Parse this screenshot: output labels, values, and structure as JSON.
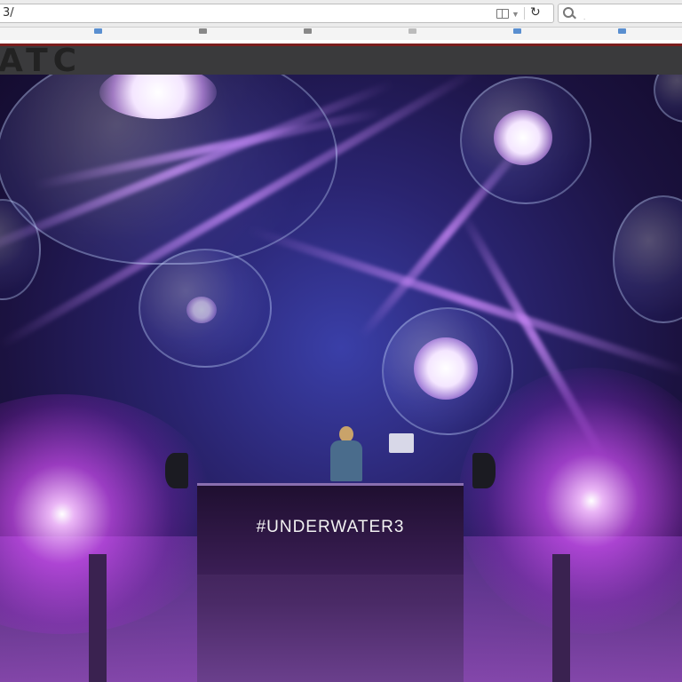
{
  "browser": {
    "url": "3/",
    "search_placeholder": ".",
    "icons": [
      "reader-view-icon",
      "dropdown-arrow-icon",
      "reload-icon",
      "search-icon"
    ]
  },
  "site": {
    "logo_text": "ATC"
  },
  "hero": {
    "stage_text": "#UNDERWATER3"
  },
  "colors": {
    "maroon_stripe": "#7a1d1d",
    "header_bg": "#3a3a3c",
    "accent_purple": "#c060ff",
    "accent_blue": "#3a6fe0"
  }
}
